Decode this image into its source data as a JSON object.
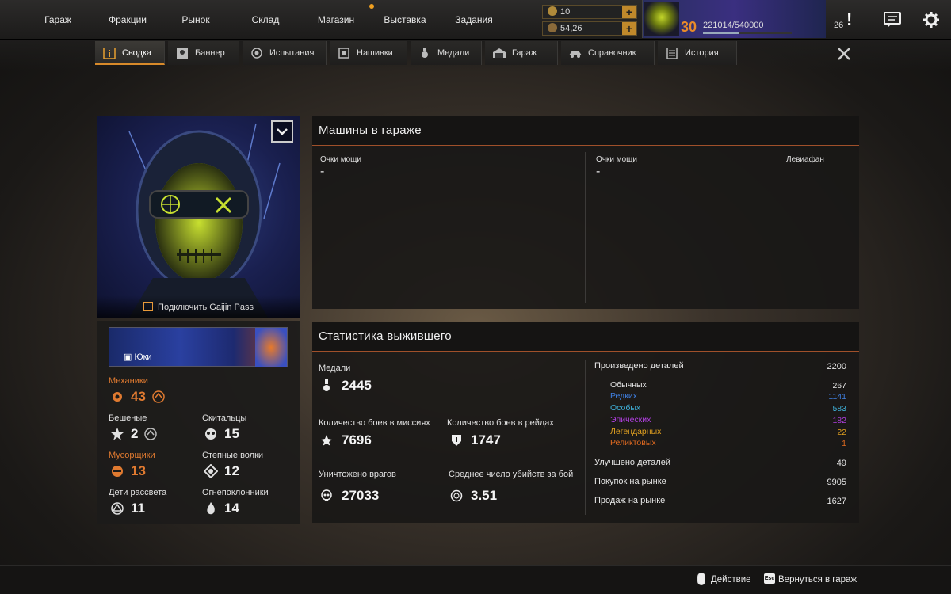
{
  "nav": {
    "items": [
      "Гараж",
      "Фракции",
      "Рынок",
      "Склад",
      "Магазин",
      "Выставка",
      "Задания"
    ]
  },
  "currency": {
    "coins": "10",
    "scrap": "54,26",
    "plus": "+"
  },
  "profile": {
    "level": "30",
    "xp": "221014/540000",
    "xp_progress": 0.41,
    "notifications": "26",
    "alert": "!"
  },
  "tabs": [
    "Сводка",
    "Баннер",
    "Испытания",
    "Нашивки",
    "Медали",
    "Гараж",
    "Справочник",
    "История"
  ],
  "portrait": {
    "gaijin_link": "Подключить Gaijin Pass"
  },
  "banner": {
    "name": "Юки"
  },
  "factions": [
    {
      "label": "Механики",
      "value": "43",
      "highlight": true
    },
    {
      "label": "Бешеные",
      "value": "2",
      "highlight": false
    },
    {
      "label": "Скитальцы",
      "value": "15",
      "highlight": false
    },
    {
      "label": "Мусорщики",
      "value": "13",
      "highlight": true
    },
    {
      "label": "Степные волки",
      "value": "12",
      "highlight": false
    },
    {
      "label": "Дети рассвета",
      "value": "11",
      "highlight": false
    },
    {
      "label": "Огнепоклонники",
      "value": "14",
      "highlight": false
    }
  ],
  "garage": {
    "title": "Машины в гараже",
    "left": {
      "label": "Очки мощи",
      "value": "-"
    },
    "right": {
      "label": "Очки мощи",
      "value": "-",
      "name": "Левиафан"
    }
  },
  "survivor": {
    "title": "Статистика выжившего",
    "medals": {
      "label": "Медали",
      "value": "2445"
    },
    "missions": {
      "label": "Количество боев в миссиях",
      "value": "7696"
    },
    "raids": {
      "label": "Количество боев в рейдах",
      "value": "1747"
    },
    "kills": {
      "label": "Уничтожено врагов",
      "value": "27033"
    },
    "avg_kills": {
      "label": "Среднее число убийств за бой",
      "value": "3.51"
    },
    "produced": {
      "label": "Произведено деталей",
      "value": "2200"
    },
    "rarities": [
      {
        "label": "Обычных",
        "value": "267",
        "color": "#e6e6e6"
      },
      {
        "label": "Редких",
        "value": "1141",
        "color": "#3f7fe0"
      },
      {
        "label": "Особых",
        "value": "583",
        "color": "#3fb0d8"
      },
      {
        "label": "Эпических",
        "value": "182",
        "color": "#b03fe0"
      },
      {
        "label": "Легендарных",
        "value": "22",
        "color": "#e0a020"
      },
      {
        "label": "Реликтовых",
        "value": "1",
        "color": "#e06a20"
      }
    ],
    "upgraded": {
      "label": "Улучшено деталей",
      "value": "49"
    },
    "bought": {
      "label": "Покупок на рынке",
      "value": "9905"
    },
    "sold": {
      "label": "Продаж на рынке",
      "value": "1627"
    }
  },
  "footer": {
    "action": "Действие",
    "esc_key": "Esc",
    "back": "Вернуться в гараж"
  }
}
